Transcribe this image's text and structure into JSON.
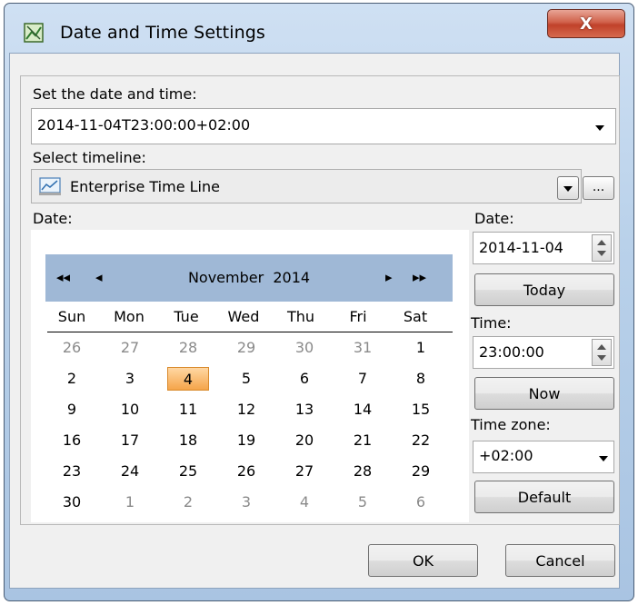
{
  "window": {
    "title": "Date and Time Settings",
    "close_glyph": "X"
  },
  "datetime": {
    "label": "Set the date and time:",
    "value": "2014-11-04T23:00:00+02:00"
  },
  "timeline": {
    "label": "Select timeline:",
    "value": "Enterprise Time Line",
    "browse_label": "..."
  },
  "calendar": {
    "label": "Date:",
    "nav_prev_year": "◂◂",
    "nav_prev_month": "◂",
    "nav_next_month": "▸",
    "nav_next_year": "▸▸",
    "month": "November",
    "year": "2014",
    "weekdays": [
      "Sun",
      "Mon",
      "Tue",
      "Wed",
      "Thu",
      "Fri",
      "Sat"
    ],
    "weeks": [
      [
        "26",
        "27",
        "28",
        "29",
        "30",
        "31",
        "1"
      ],
      [
        "2",
        "3",
        "4",
        "5",
        "6",
        "7",
        "8"
      ],
      [
        "9",
        "10",
        "11",
        "12",
        "13",
        "14",
        "15"
      ],
      [
        "16",
        "17",
        "18",
        "19",
        "20",
        "21",
        "22"
      ],
      [
        "23",
        "24",
        "25",
        "26",
        "27",
        "28",
        "29"
      ],
      [
        "30",
        "1",
        "2",
        "3",
        "4",
        "5",
        "6"
      ]
    ],
    "selected_day": "4"
  },
  "side": {
    "date_label": "Date:",
    "date_value": "2014-11-04",
    "today_label": "Today",
    "time_label": "Time:",
    "time_value": "23:00:00",
    "now_label": "Now",
    "zone_label": "Time zone:",
    "zone_value": "+02:00",
    "default_label": "Default"
  },
  "footer": {
    "ok_label": "OK",
    "cancel_label": "Cancel"
  },
  "colors": {
    "calendar_header": "#9fb8d6",
    "selected_day": "#f5a54a",
    "close_button": "#c0412a"
  }
}
